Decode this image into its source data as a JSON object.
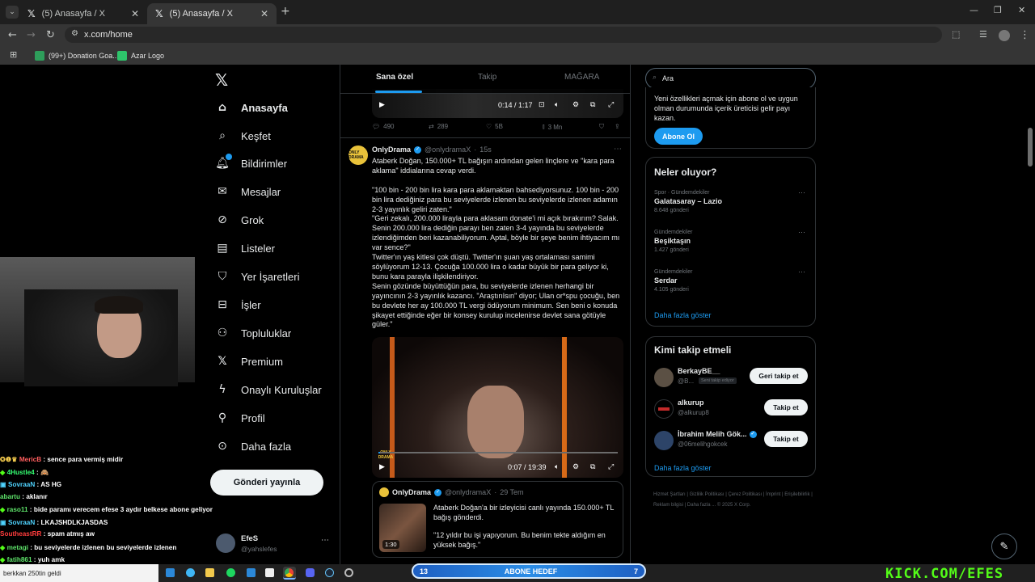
{
  "browser": {
    "tabs": [
      {
        "title": "(5) Anasayfa / X"
      },
      {
        "title": "(5) Anasayfa / X"
      }
    ],
    "url": "x.com/home",
    "bookmarks": [
      {
        "label": "(99+) Donation Goa..."
      },
      {
        "label": "Azar Logo"
      }
    ]
  },
  "sidebar": {
    "items": [
      {
        "label": "Anasayfa",
        "icon": "home-icon"
      },
      {
        "label": "Keşfet",
        "icon": "search-icon"
      },
      {
        "label": "Bildirimler",
        "icon": "bell-icon"
      },
      {
        "label": "Mesajlar",
        "icon": "mail-icon"
      },
      {
        "label": "Grok",
        "icon": "grok-icon"
      },
      {
        "label": "Listeler",
        "icon": "list-icon"
      },
      {
        "label": "Yer İşaretleri",
        "icon": "bookmark-icon"
      },
      {
        "label": "İşler",
        "icon": "briefcase-icon"
      },
      {
        "label": "Topluluklar",
        "icon": "people-icon"
      },
      {
        "label": "Premium",
        "icon": "x-icon"
      },
      {
        "label": "Onaylı Kuruluşlar",
        "icon": "bolt-icon"
      },
      {
        "label": "Profil",
        "icon": "person-icon"
      },
      {
        "label": "Daha fazla",
        "icon": "more-circle-icon"
      }
    ],
    "post_button": "Gönderi yayınla",
    "profile": {
      "name": "EfeS",
      "handle": "@yahslefes"
    }
  },
  "feed": {
    "tabs": [
      {
        "label": "Sana özel",
        "active": true
      },
      {
        "label": "Takip",
        "active": false
      },
      {
        "label": "MAĞARA",
        "active": false
      }
    ],
    "prev_post": {
      "video_time": "0:14 / 1:17",
      "replies": "490",
      "reposts": "289",
      "likes": "5B",
      "views": "3 Mn"
    },
    "post": {
      "author": "OnlyDrama",
      "handle": "@onlydramaX",
      "time": "15s",
      "text": "Ataberk Doğan, 150.000+ TL bağışın ardından gelen linçlere ve \"kara para aklama\" iddialarına cevap verdi.\n\n\"100 bin - 200 bin lira kara para aklamaktan bahsediyorsunuz. 100 bin - 200 bin lira dediğiniz para bu seviyelerde izlenen bu seviyelerde izlenen adamın 2-3 yayınlık geliri zaten.\"\n\"Geri zekalı, 200.000 lirayla para aklasam donate'i mi açık bırakırım? Salak. Senin 200.000 lira dediğin parayı ben zaten 3-4 yayında bu seviyelerde izlendiğimden beri kazanabiliyorum. Aptal, böyle bir şeye benim ihtiyacım mı var sence?\"\nTwitter'ın yaş kitlesi çok düştü. Twitter'ın şuan yaş ortalaması samimi söylüyorum 12-13. Çocuğa 100.000 lira o kadar büyük bir para geliyor ki, bunu kara parayla ilişkilendiriyor.\nSenin gözünde büyüttüğün para, bu seviyelerde izlenen herhangi bir yayıncının 2-3 yayınlık kazancı. \"Araştırılsın\" diyor; Ulan or*spu çocuğu, ben bu devlete her ay 100.000 TL vergi ödüyorum minimum. Sen beni o konuda şikayet ettiğinde eğer bir konsey kurulup incelenirse devlet sana götüyle güler.\"",
      "video_time": "0:07 / 19:39",
      "video_progress": 0.006,
      "video_overlay_brand": "ONLY DRAMA"
    },
    "quote": {
      "author": "OnlyDrama",
      "handle": "@onlydramaX",
      "date": "29 Tem",
      "duration": "1:30",
      "text1": "Ataberk Doğan'a bir izleyicisi canlı yayında 150.000+ TL bağış gönderdi.",
      "text2": "\"12 yıldır bu işi yapıyorum. Bu benim tekte aldığım en yüksek bağış.\""
    }
  },
  "right": {
    "search_placeholder": "Ara",
    "premium": {
      "text": "Yeni özellikleri açmak için abone ol ve uygun olman durumunda içerik üreticisi gelir payı kazan.",
      "button": "Abone Ol"
    },
    "trends": {
      "title": "Neler oluyor?",
      "items": [
        {
          "meta": "Spor · Gündemdekiler",
          "name": "Galatasaray – Lazio",
          "count": "8.648 gönderi"
        },
        {
          "meta": "Gündemdekiler",
          "name": "Beşiktaşın",
          "count": "1.427 gönderi"
        },
        {
          "meta": "Gündemdekiler",
          "name": "Serdar",
          "count": "4.105 gönderi"
        }
      ],
      "more": "Daha fazla göster"
    },
    "who_to_follow": {
      "title": "Kimi takip etmeli",
      "items": [
        {
          "name": "BerkayBE__",
          "handle": "@B...",
          "badge": "Seni takip ediyor",
          "button": "Geri takip et"
        },
        {
          "name": "alkurup",
          "handle": "@alkurup8",
          "button": "Takip et"
        },
        {
          "name": "İbrahim Melih Gök...",
          "handle": "@06melihgokcek",
          "button": "Takip et"
        }
      ],
      "more": "Daha fazla göster"
    },
    "footer": "Hizmet Şartları | Gizlilik Politikası | Çerez Politikası | İmprint | Erişilebilirlik | Reklam bilgisi | Daha fazla ... © 2025 X Corp."
  },
  "stream": {
    "chat": [
      {
        "user": "MericB",
        "color": "#ff5e5e",
        "msg": "sence para vermiş midir",
        "prefix": "✪❶♛"
      },
      {
        "user": "4Hustle4",
        "color": "#35ff72",
        "msg": "🙈",
        "prefix": "◆"
      },
      {
        "user": "SovraaN",
        "color": "#4fd3ff",
        "msg": "AS HG",
        "prefix": "▣"
      },
      {
        "user": "abartu",
        "color": "#5ee36a",
        "msg": "aklanır",
        "prefix": ""
      },
      {
        "user": "raso11",
        "color": "#5ee36a",
        "msg": "bide paramı verecem efese 3 aydır belkese abone geliyor",
        "prefix": "◆"
      },
      {
        "user": "SovraaN",
        "color": "#4fd3ff",
        "msg": "LKAJSHDLKJASDAS",
        "prefix": "▣"
      },
      {
        "user": "SoutheastRR",
        "color": "#ff3d3d",
        "msg": "spam atmış aw",
        "prefix": ""
      },
      {
        "user": "metagi",
        "color": "#5ee36a",
        "msg": "bu seviyelerde izlenen bu seviyelerde izlenen",
        "prefix": "◆"
      },
      {
        "user": "fatih861",
        "color": "#5ee36a",
        "msg": "yuh amk",
        "prefix": "◆"
      }
    ],
    "sub_goal": {
      "label": "ABONE HEDEF",
      "current": "13",
      "target": "7"
    },
    "kick_brand": "KICK.COM/EFES",
    "taskbar_note": "berkkan 250tin geldi"
  }
}
